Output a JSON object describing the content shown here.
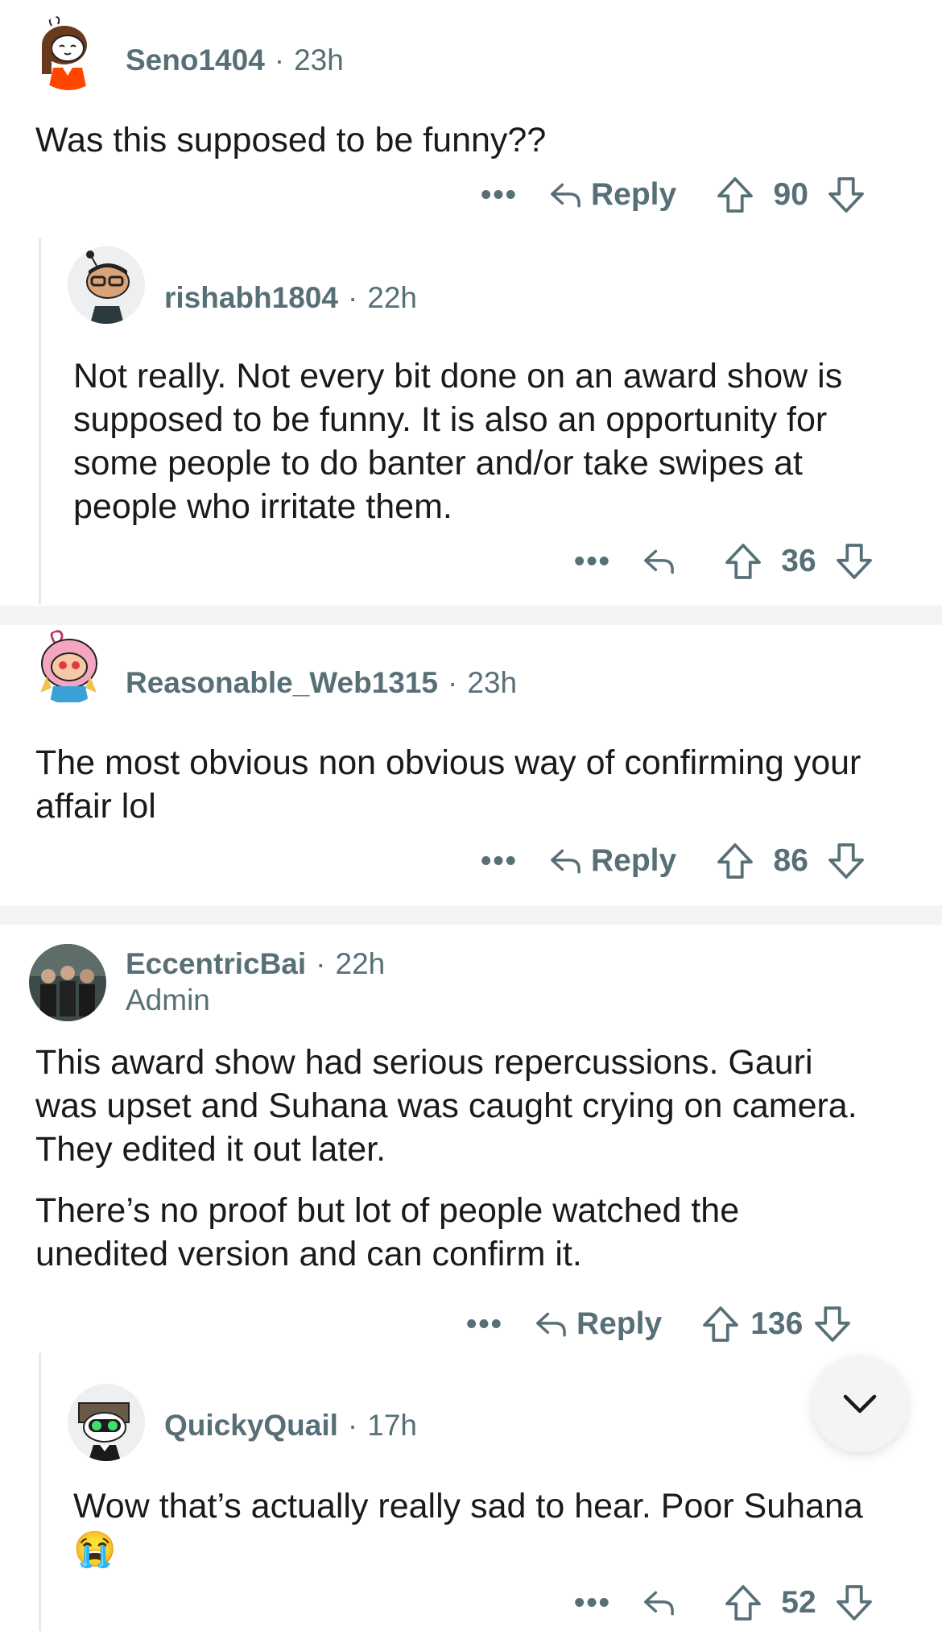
{
  "comments": [
    {
      "username": "Seno1404",
      "time": "23h",
      "body": [
        "Was this supposed to be funny??"
      ],
      "reply_label": "Reply",
      "score": "90",
      "avatar": "snoo-avatar-girl"
    },
    {
      "username": "rishabh1804",
      "time": "22h",
      "body": [
        "Not really. Not every bit done on an award show is supposed to be funny. It is also an opportunity for some people to do banter and/or take swipes at people who irritate them."
      ],
      "score": "36",
      "avatar": "snoo-avatar-glasses"
    },
    {
      "username": "Reasonable_Web1315",
      "time": "23h",
      "body": [
        "The most obvious non obvious way of confirming your affair lol"
      ],
      "reply_label": "Reply",
      "score": "86",
      "avatar": "snoo-avatar-pink-hood"
    },
    {
      "username": "EccentricBai",
      "time": "22h",
      "flair": "Admin",
      "body": [
        "This award show had serious repercussions. Gauri was upset and Suhana was caught crying on camera. They edited it out later.",
        "There’s no proof but lot of people watched the unedited version and can confirm it."
      ],
      "reply_label": "Reply",
      "score": "136",
      "avatar": "photo-avatar-group"
    },
    {
      "username": "QuickyQuail",
      "time": "17h",
      "body": [
        "Wow that’s actually really sad to hear. Poor Suhana 😭"
      ],
      "score": "52",
      "avatar": "snoo-avatar-goggles"
    }
  ],
  "icons": {
    "more": "more-options-icon",
    "reply": "reply-arrow-icon",
    "upvote": "upvote-arrow-icon",
    "downvote": "downvote-arrow-icon",
    "scroll": "chevron-down-icon"
  },
  "colors": {
    "meta": "#576f76",
    "text": "#1a1a1b",
    "separator": "#f2f4f5"
  }
}
